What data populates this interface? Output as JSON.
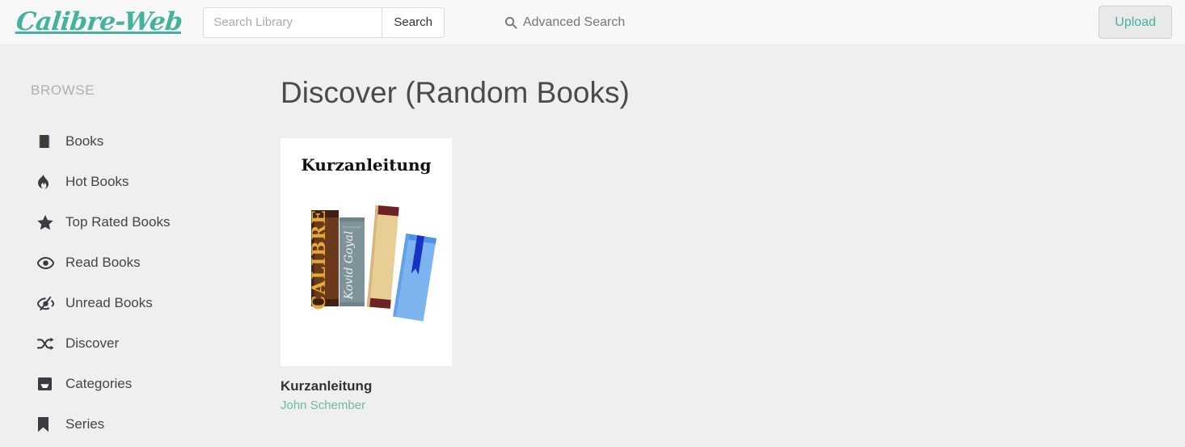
{
  "navbar": {
    "brand": "Calibre-Web",
    "search": {
      "placeholder": "Search Library",
      "value": "",
      "button_label": "Search"
    },
    "advanced_search_label": "Advanced Search",
    "advanced_search_icon": "search-icon",
    "upload_label": "Upload"
  },
  "sidebar": {
    "heading": "BROWSE",
    "items": [
      {
        "label": "Books",
        "icon": "book-icon"
      },
      {
        "label": "Hot Books",
        "icon": "fire-icon"
      },
      {
        "label": "Top Rated Books",
        "icon": "star-icon"
      },
      {
        "label": "Read Books",
        "icon": "eye-icon"
      },
      {
        "label": "Unread Books",
        "icon": "eye-slash-icon"
      },
      {
        "label": "Discover",
        "icon": "shuffle-icon"
      },
      {
        "label": "Categories",
        "icon": "inbox-icon"
      },
      {
        "label": "Series",
        "icon": "bookmark-icon"
      }
    ]
  },
  "main": {
    "title": "Discover (Random Books)",
    "books": [
      {
        "title": "Kurzanleitung",
        "author": "John Schember",
        "cover": {
          "heading": "Kurzanleitung",
          "spine_brand": "CALIBRE",
          "spine_author": "Kovid Goyal"
        }
      }
    ]
  },
  "colors": {
    "accent": "#45b29d",
    "author_link": "#6bb9a8",
    "navbar_bg": "#f8f8f8",
    "body_bg": "#efefef",
    "text": "#444444",
    "muted": "#b0b0b0"
  }
}
